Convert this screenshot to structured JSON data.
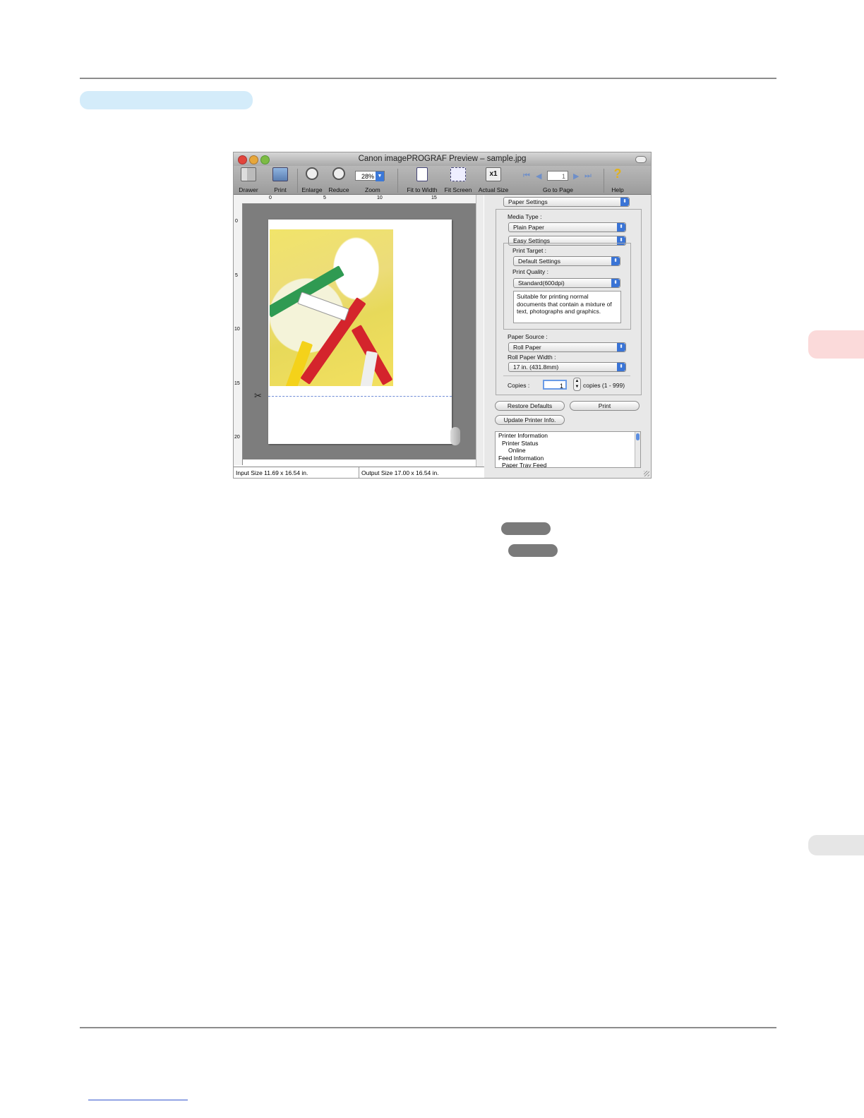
{
  "window": {
    "title": "Canon imagePROGRAF Preview – sample.jpg"
  },
  "toolbar": {
    "drawer": "Drawer",
    "print": "Print",
    "enlarge": "Enlarge",
    "reduce": "Reduce",
    "zoom_value": "28%",
    "zoom": "Zoom",
    "fit_to_width": "Fit to Width",
    "fit_screen": "Fit Screen",
    "actual_size_glyph": "x1",
    "actual_size": "Actual Size",
    "page_value": "1",
    "go_to_page": "Go to Page",
    "help": "Help"
  },
  "ruler": {
    "h_ticks": [
      "0",
      "5",
      "10",
      "15"
    ],
    "v_ticks": [
      "0",
      "5",
      "10",
      "15",
      "20"
    ]
  },
  "status": {
    "input_size": "Input Size 11.69 x 16.54 in.",
    "output_size": "Output Size 17.00 x 16.54 in."
  },
  "panel": {
    "settings_menu": "Paper Settings",
    "media_type_label": "Media Type :",
    "media_type_value": "Plain Paper",
    "mode_value": "Easy Settings",
    "print_target_label": "Print Target :",
    "print_target_value": "Default Settings",
    "print_quality_label": "Print Quality :",
    "print_quality_value": "Standard(600dpi)",
    "description": "Suitable for printing normal documents that contain a mixture of text, photographs and graphics.",
    "paper_source_label": "Paper Source :",
    "paper_source_value": "Roll Paper",
    "roll_width_label": "Roll Paper Width :",
    "roll_width_value": "17 in. (431.8mm)",
    "copies_label": "Copies :",
    "copies_value": "1",
    "copies_range": "copies (1 - 999)",
    "restore_defaults": "Restore Defaults",
    "print_button": "Print",
    "update_printer_info": "Update Printer Info.",
    "info_lines": [
      "Printer Information",
      "Printer Status",
      "Online",
      "Feed Information",
      "Paper Tray Feed"
    ]
  },
  "colors": {
    "header_pill": "#d4ecfa",
    "side_tab": "#fbdada",
    "side_tab_gray": "#e6e6e6",
    "hint_pill": "#7a7a7a",
    "accent_blue": "#3a74d6"
  }
}
